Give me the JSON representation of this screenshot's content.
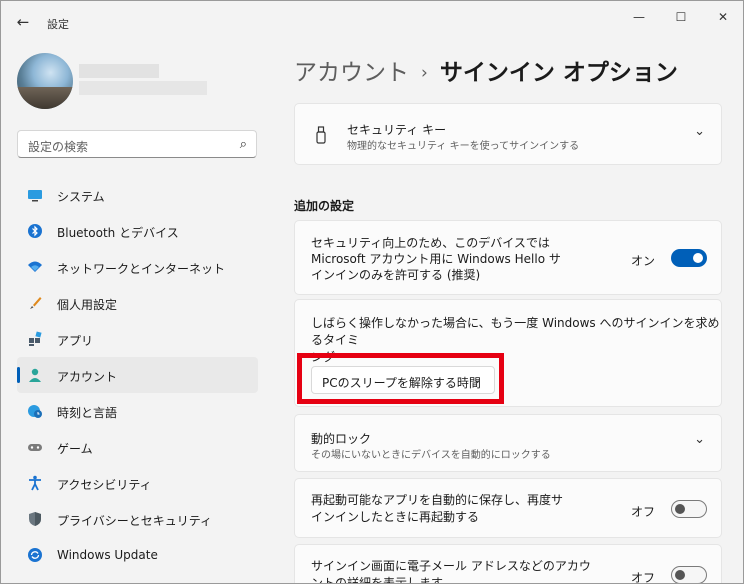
{
  "window": {
    "title": "設定",
    "back_icon": "←",
    "minimize_icon": "—",
    "maximize_icon": "☐",
    "close_icon": "✕"
  },
  "search": {
    "placeholder": "設定の検索",
    "icon": "⌕"
  },
  "nav": {
    "items": [
      {
        "label": "システム",
        "icon": "system-icon"
      },
      {
        "label": "Bluetooth とデバイス",
        "icon": "bluetooth-icon"
      },
      {
        "label": "ネットワークとインターネット",
        "icon": "wifi-icon"
      },
      {
        "label": "個人用設定",
        "icon": "brush-icon"
      },
      {
        "label": "アプリ",
        "icon": "apps-icon"
      },
      {
        "label": "アカウント",
        "icon": "account-icon",
        "active": true
      },
      {
        "label": "時刻と言語",
        "icon": "globe-clock-icon"
      },
      {
        "label": "ゲーム",
        "icon": "gamepad-icon"
      },
      {
        "label": "アクセシビリティ",
        "icon": "accessibility-icon"
      },
      {
        "label": "プライバシーとセキュリティ",
        "icon": "shield-icon"
      },
      {
        "label": "Windows Update",
        "icon": "update-icon"
      }
    ]
  },
  "header": {
    "parent": "アカウント",
    "separator": "›",
    "current": "サインイン オプション"
  },
  "security_key": {
    "title": "セキュリティ キー",
    "subtitle": "物理的なセキュリティ キーを使ってサインインする",
    "chevron": "⌄"
  },
  "additional_label": "追加の設定",
  "hello_only": {
    "text_lines": [
      "セキュリティ向上のため、このデバイスでは",
      "Microsoft アカウント用に Windows Hello サ",
      "インインのみを許可する (推奨)"
    ],
    "state": "オン",
    "on": true
  },
  "signin_timing": {
    "text_lines": [
      "しばらく操作しなかった場合に、もう一度 Windows へのサインインを求めるタイミ",
      "ング"
    ],
    "dropdown_value": "PCのスリープを解除する時間",
    "dropdown_chevron": "⌄"
  },
  "dynamic_lock": {
    "title": "動的ロック",
    "subtitle": "その場にいないときにデバイスを自動的にロックする",
    "chevron": "⌄"
  },
  "restart_apps": {
    "text_lines": [
      "再起動可能なアプリを自動的に保存し、再度サ",
      "インインしたときに再起動する"
    ],
    "state": "オフ",
    "on": false
  },
  "show_account_details": {
    "text_lines": [
      "サインイン画面に電子メール アドレスなどのアカウ",
      "ントの詳細を表示します"
    ],
    "state": "オフ",
    "on": false
  },
  "colors": {
    "accent": "#005fb8",
    "highlight": "#e60012"
  }
}
